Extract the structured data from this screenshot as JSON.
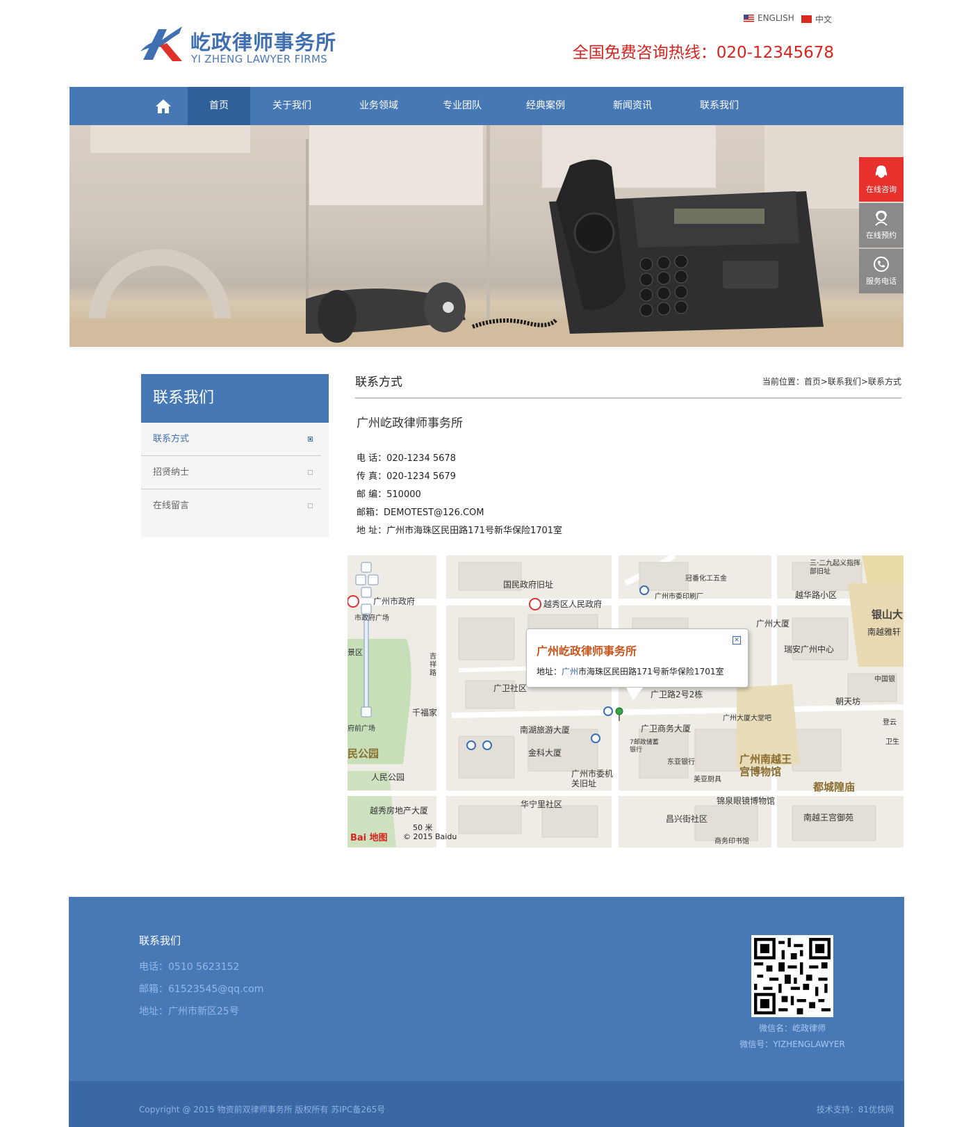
{
  "header": {
    "logo_cn": "屹政律师事务所",
    "logo_en": "YI ZHENG LAWYER FIRMS",
    "lang_english": "ENGLISH",
    "lang_chinese": "中文",
    "hotline": "全国免费咨询热线：020-12345678"
  },
  "nav": {
    "home_icon": "home-icon",
    "items": [
      "首页",
      "关于我们",
      "业务领域",
      "专业团队",
      "经典案例",
      "新闻资讯",
      "联系我们"
    ],
    "active": "首页"
  },
  "side_buttons": [
    {
      "label": "在线咨询",
      "icon": "qq-icon",
      "color": "#e8312c"
    },
    {
      "label": "在线预约",
      "icon": "agent-icon",
      "color": "#8a8a8a"
    },
    {
      "label": "服务电话",
      "icon": "phone-icon",
      "color": "#8a8a8a"
    }
  ],
  "sidebar": {
    "title": "联系我们",
    "items": [
      "联系方式",
      "招贤纳士",
      "在线留言"
    ],
    "active": "联系方式"
  },
  "main": {
    "section_title": "联系方式",
    "breadcrumb": "当前位置：首页>联系我们>联系方式",
    "company": "广州屹政律师事务所",
    "phone": "电 话：020-1234 5678",
    "fax": "传 真：020-1234 5679",
    "postcode": "邮 编：510000",
    "email": "邮箱：DEMOTEST@126.COM",
    "address": "地 址：广州市海珠区民田路171号新华保险1701室"
  },
  "map": {
    "popup_title": "广州屹政律师事务所",
    "popup_addr_prefix": "地址：",
    "popup_addr_city": "广州",
    "popup_addr_rest": "市海珠区民田路171号新华保险1701室",
    "scale": "50 米",
    "copyright": "© 2015 Baidu",
    "baidu_logo": "Bai 地图",
    "labels": [
      "国民政府旧址",
      "越秀区人民政府",
      "广州市委印刷厂",
      "冠番化工五金",
      "三·二九起义指挥部旧址",
      "越华路小区",
      "广州大厦",
      "银山大",
      "南越雅轩",
      "瑞安广州中心",
      "广州市政府",
      "市政府广场",
      "广卫社区",
      "广卫路2号2栋",
      "千福家",
      "朝天坊",
      "南湖旅游大厦",
      "广卫商务大厦",
      "广州大厦大堂吧",
      "金科大厦",
      "广州市委机关旧址",
      "东亚银行",
      "美亚厨具",
      "广州南越王宫博物馆",
      "都城隍庙",
      "人民公园",
      "华宁里社区",
      "锦泉眼镜博物馆",
      "越秀房地产大厦",
      "昌兴街社区",
      "南越王宫御苑",
      "商务印书馆",
      "吉祥路",
      "7邮政储蓄银行",
      "中国银",
      "登云",
      "卫生",
      "民公园",
      "府前广场",
      "景区"
    ]
  },
  "footer": {
    "title": "联系我们",
    "phone": "电话：0510 5623152",
    "email": "邮箱：61523545@qq.com",
    "address": "地址：广州市新区25号",
    "wechat_name": "微信名：屹政律师",
    "wechat_id": "微信号：YIZHENGLAWYER",
    "copyright": "Copyright @ 2015 物资前双律师事务所 版权所有  苏IPC备265号",
    "support": "技术支持：81优快网"
  },
  "colors": {
    "brand_blue": "#4678b5",
    "nav_active": "#30609a",
    "hotline_red": "#d8231f",
    "footer_blue": "#4879b7"
  }
}
